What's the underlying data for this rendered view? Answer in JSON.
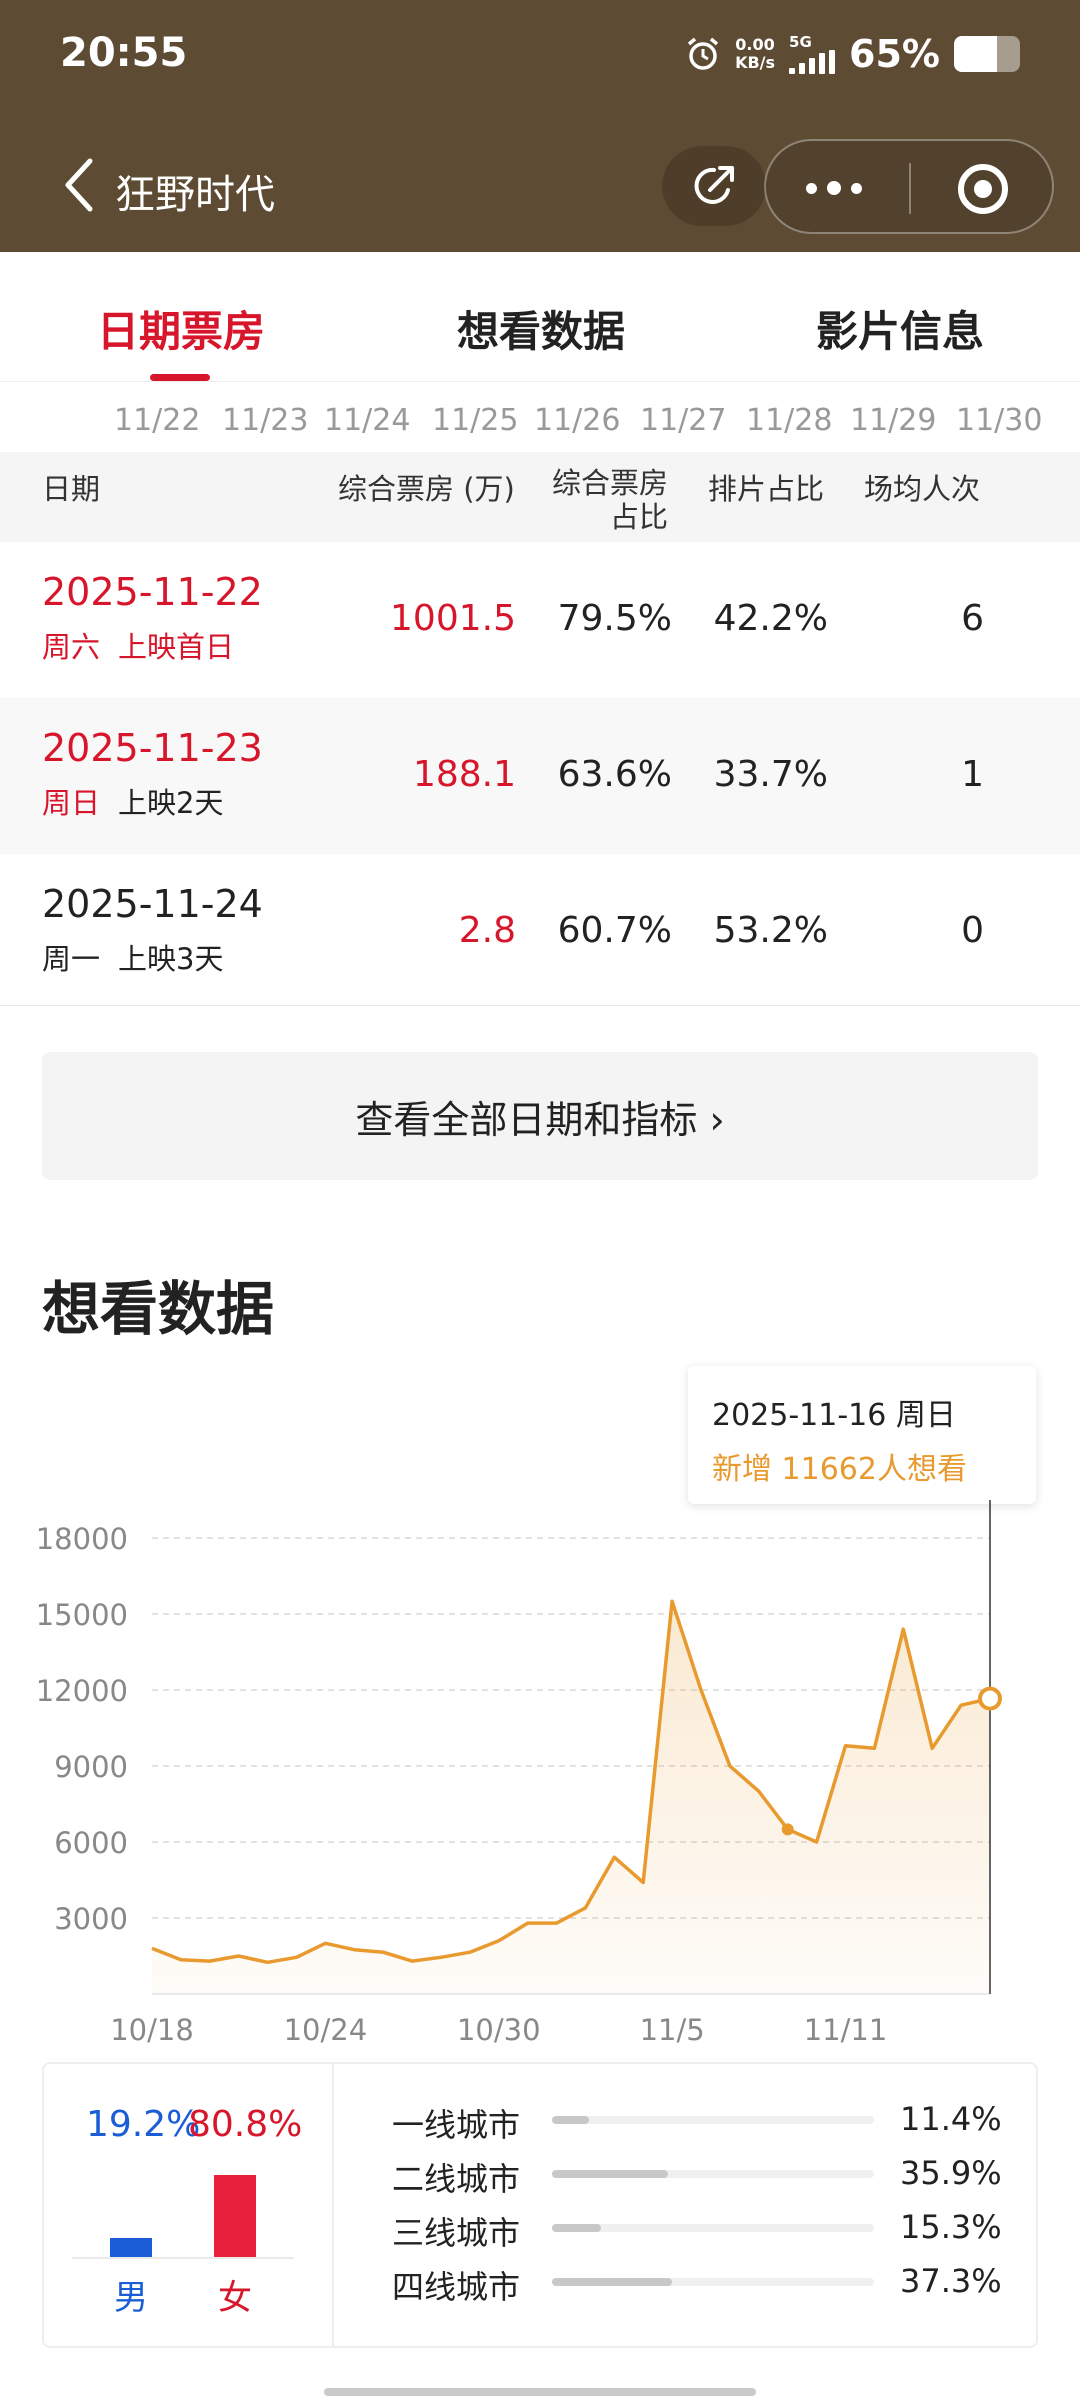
{
  "status_bar": {
    "time": "20:55",
    "net_speed_value": "0.00",
    "net_speed_unit": "KB/s",
    "network": "5G",
    "battery_percent": "65%",
    "battery_level": 0.65
  },
  "header": {
    "title": "狂野时代"
  },
  "tabs": [
    {
      "label": "日期票房",
      "active": true
    },
    {
      "label": "想看数据",
      "active": false
    },
    {
      "label": "影片信息",
      "active": false
    }
  ],
  "date_strip": [
    "11/22",
    "11/23",
    "11/24",
    "11/25",
    "11/26",
    "11/27",
    "11/28",
    "11/29",
    "11/30"
  ],
  "table": {
    "headers": {
      "date": "日期",
      "box_office": "综合票房 (万)",
      "box_share_1": "综合票房",
      "box_share_2": "占比",
      "screen_share": "排片占比",
      "avg_attendance": "场均人次"
    },
    "rows": [
      {
        "date": "2025-11-22",
        "weekday": "周六",
        "release": "上映首日",
        "box_office": "1001.5",
        "box_share": "79.5%",
        "screen_share": "42.2%",
        "avg_attendance": "6"
      },
      {
        "date": "2025-11-23",
        "weekday": "周日",
        "release": "上映2天",
        "box_office": "188.1",
        "box_share": "63.6%",
        "screen_share": "33.7%",
        "avg_attendance": "1"
      },
      {
        "date": "2025-11-24",
        "weekday": "周一",
        "release": "上映3天",
        "box_office": "2.8",
        "box_share": "60.7%",
        "screen_share": "53.2%",
        "avg_attendance": "0"
      }
    ]
  },
  "view_all_label": "查看全部日期和指标 ›",
  "want_section_title": "想看数据",
  "tooltip": {
    "date_line": "2025-11-16 周日",
    "value_line": "新增 11662人想看"
  },
  "chart_data": {
    "type": "area",
    "x_tick_labels": [
      "10/18",
      "10/24",
      "10/30",
      "11/5",
      "11/11"
    ],
    "y_tick_labels": [
      "18000",
      "15000",
      "12000",
      "9000",
      "6000",
      "3000"
    ],
    "ylim": [
      0,
      18000
    ],
    "grid": true,
    "color": "#e89a2e",
    "x": [
      "10/18",
      "10/19",
      "10/20",
      "10/21",
      "10/22",
      "10/23",
      "10/24",
      "10/25",
      "10/26",
      "10/27",
      "10/28",
      "10/29",
      "10/30",
      "10/31",
      "11/1",
      "11/2",
      "11/3",
      "11/4",
      "11/5",
      "11/6",
      "11/7",
      "11/8",
      "11/9",
      "11/10",
      "11/11",
      "11/12",
      "11/13",
      "11/14",
      "11/15",
      "11/16"
    ],
    "values": [
      1800,
      1350,
      1300,
      1500,
      1250,
      1450,
      2000,
      1750,
      1650,
      1300,
      1450,
      1650,
      2100,
      2800,
      2800,
      3400,
      5400,
      4400,
      15500,
      12000,
      9000,
      8000,
      6500,
      6000,
      9800,
      9700,
      14400,
      9700,
      11400,
      11662
    ],
    "highlight_index": 29,
    "marked_index": 22
  },
  "gender": {
    "male_pct": "19.2%",
    "female_pct": "80.8%",
    "male_value": 0.192,
    "female_value": 0.808,
    "male_label": "男",
    "female_label": "女",
    "male_color": "#1a5dd6",
    "female_color": "#e8203b"
  },
  "cities": [
    {
      "name": "一线城市",
      "pct": "11.4%",
      "value": 0.114
    },
    {
      "name": "二线城市",
      "pct": "35.9%",
      "value": 0.359
    },
    {
      "name": "三线城市",
      "pct": "15.3%",
      "value": 0.153
    },
    {
      "name": "四线城市",
      "pct": "37.3%",
      "value": 0.373
    }
  ]
}
